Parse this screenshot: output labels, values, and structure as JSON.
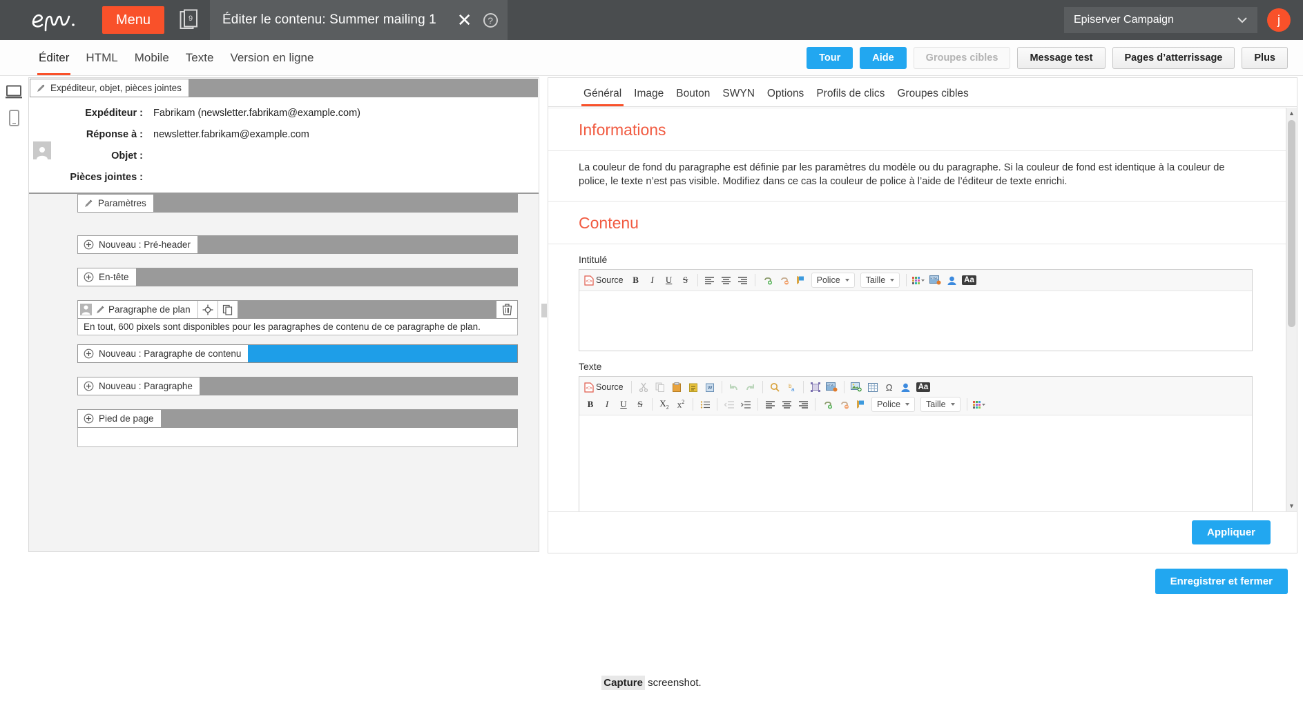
{
  "topbar": {
    "logo_alt": "epi-logo",
    "menu_label": "Menu",
    "doc_badge": "9",
    "title": "Éditer le contenu: Summer mailing 1",
    "close_glyph": "✕",
    "help_glyph": "?",
    "client": "Episerver Campaign",
    "avatar_initial": "j",
    "accent": "#f9512a",
    "bar_bg": "#4a4d4f"
  },
  "subnav": {
    "tabs": [
      {
        "label": "Éditer",
        "active": true
      },
      {
        "label": "HTML",
        "active": false
      },
      {
        "label": "Mobile",
        "active": false
      },
      {
        "label": "Texte",
        "active": false
      },
      {
        "label": "Version en ligne",
        "active": false
      }
    ],
    "actions": [
      {
        "label": "Tour",
        "style": "blue"
      },
      {
        "label": "Aide",
        "style": "blue"
      },
      {
        "label": "Groupes cibles",
        "style": "disabled"
      },
      {
        "label": "Message test",
        "style": "gray"
      },
      {
        "label": "Pages d’atterrissage",
        "style": "gray"
      },
      {
        "label": "Plus",
        "style": "gray"
      }
    ]
  },
  "device_rail": [
    {
      "icon": "desktop-icon",
      "active": true
    },
    {
      "icon": "mobile-icon",
      "active": false
    }
  ],
  "left_panel": {
    "sender_block": {
      "header_label": "Expéditeur, objet, pièces jointes",
      "header_icon": "pencil-icon",
      "fields": [
        {
          "label": "Expéditeur :",
          "value": "Fabrikam (newsletter.fabrikam@example.com)"
        },
        {
          "label": "Réponse à :",
          "value": "newsletter.fabrikam@example.com"
        },
        {
          "label": "Objet :",
          "value": ""
        },
        {
          "label": "Pièces jointes :",
          "value": ""
        }
      ]
    },
    "blocks": [
      {
        "label": "Paramètres",
        "icon": "pencil-icon",
        "fill": "gray",
        "indent": 0
      },
      {
        "label": "Nouveau : Pré-header",
        "icon": "plus-circle-icon",
        "fill": "gray",
        "indent": 0
      },
      {
        "label": "En-tête",
        "icon": "plus-circle-icon",
        "fill": "gray",
        "indent": 0
      },
      {
        "label": "Paragraphe de plan",
        "icon": "pencil-icon",
        "fill": "gray",
        "indent": 0,
        "avatar": true,
        "tools": [
          "target-icon",
          "copy-icon"
        ],
        "trash": "trash-icon",
        "note": "En tout, 600 pixels sont disponibles pour les paragraphes de contenu de ce paragraphe de plan."
      },
      {
        "label": "Nouveau : Paragraphe de contenu",
        "icon": "plus-circle-icon",
        "fill": "blue",
        "indent": 0
      },
      {
        "label": "Nouveau : Paragraphe",
        "icon": "plus-circle-icon",
        "fill": "gray",
        "indent": 0
      },
      {
        "label": "Pied de page",
        "icon": "plus-circle-icon",
        "fill": "gray",
        "indent": 0
      }
    ]
  },
  "right_panel": {
    "tabs": [
      {
        "label": "Général",
        "active": true
      },
      {
        "label": "Image",
        "active": false
      },
      {
        "label": "Bouton",
        "active": false
      },
      {
        "label": "SWYN",
        "active": false
      },
      {
        "label": "Options",
        "active": false
      },
      {
        "label": "Profils de clics",
        "active": false
      },
      {
        "label": "Groupes cibles",
        "active": false
      }
    ],
    "info_title": "Informations",
    "info_text": "La couleur de fond du paragraphe est définie par les paramètres du modèle ou du paragraphe. Si la couleur de fond est identique à la couleur de police, le texte n’est pas visible. Modifiez dans ce cas la couleur de police à l’aide de l’éditeur de texte enrichi.",
    "content_title": "Contenu",
    "field_intitule_label": "Intitulé",
    "field_texte_label": "Texte",
    "editor_intitule": {
      "source_label": "Source",
      "font_label": "Police",
      "size_label": "Taille",
      "row1": [
        "source-icon",
        "bold-icon",
        "italic-icon",
        "underline-icon",
        "strikethrough-icon",
        "align-left-icon",
        "align-center-icon",
        "align-right-icon",
        "link-icon",
        "unlink-icon",
        "anchor-icon",
        "font-combo",
        "size-combo",
        "text-color-icon",
        "html-field-icon",
        "personalization-icon",
        "special-format-icon"
      ]
    },
    "editor_texte": {
      "source_label": "Source",
      "font_label": "Police",
      "size_label": "Taille",
      "row1": [
        "source-icon",
        "cut-icon",
        "copy-icon",
        "paste-icon",
        "paste-text-icon",
        "paste-word-icon",
        "undo-icon",
        "redo-icon",
        "find-icon",
        "replace-icon",
        "select-all-icon",
        "html-field-icon",
        "image-icon",
        "table-icon",
        "special-char-icon",
        "personalization-icon",
        "special-format-icon"
      ],
      "row2": [
        "bold-icon",
        "italic-icon",
        "underline-icon",
        "strikethrough-icon",
        "subscript-icon",
        "superscript-icon",
        "bulleted-list-icon",
        "outdent-icon",
        "indent-icon",
        "align-left-icon",
        "align-center-icon",
        "align-right-icon",
        "link-icon",
        "unlink-icon",
        "anchor-icon",
        "font-combo",
        "size-combo",
        "text-color-icon"
      ]
    },
    "apply_label": "Appliquer"
  },
  "footer": {
    "save_label": "Enregistrer et fermer",
    "capture_bold": "Capture",
    "capture_rest": " screenshot."
  }
}
